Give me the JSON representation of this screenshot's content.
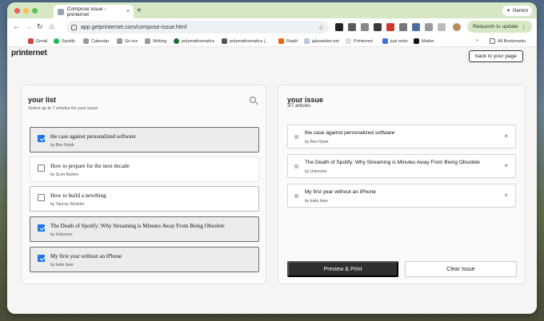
{
  "browser": {
    "tab_title": "Compose issue - printernet",
    "tab_close": "×",
    "new_tab": "+",
    "gemini_label": "Gemini",
    "url": "app.getprinternet.com/compose-issue.html",
    "relaunch_label": "Relaunch to update",
    "bookmarks": [
      "Gmail",
      "Spotify",
      "Calendar",
      "Go tos",
      "Writing",
      "polymathematics",
      "polymathematics |...",
      "Replit",
      "jakeweber.net",
      "Printernet",
      "just write",
      "Matter"
    ],
    "bookmarks_more": "»",
    "all_bookmarks": "All Bookmarks"
  },
  "app": {
    "brand": "printernet",
    "back_button": "back to your page"
  },
  "list": {
    "title": "your list",
    "subtitle": "Select up to 7 articles for your issue",
    "items": [
      {
        "title": "the case against personalized software",
        "author": "by Ben Hylak",
        "checked": true
      },
      {
        "title": "How to prepare for the next decade",
        "author": "by Scott Banker",
        "checked": false
      },
      {
        "title": "How to build a newthing",
        "author": "by Yancey Strickler",
        "checked": false
      },
      {
        "title": "The Death of Spotify: Why Streaming is Minutes Away From Being Obsolete",
        "author": "by Unknown",
        "checked": true
      },
      {
        "title": "My first year without an iPhone",
        "author": "by katie lowe",
        "checked": true
      }
    ]
  },
  "issue": {
    "title": "your issue",
    "count": "3/7 articles",
    "remove_glyph": "×",
    "items": [
      {
        "title": "the case against personalized software",
        "author": "by Ben Hylak"
      },
      {
        "title": "The Death of Spotify: Why Streaming is Minutes Away From Being Obsolete",
        "author": "by Unknown"
      },
      {
        "title": "My first year without an iPhone",
        "author": "by katie lowe"
      }
    ],
    "preview_button": "Preview & Print",
    "clear_button": "Clear Issue"
  }
}
